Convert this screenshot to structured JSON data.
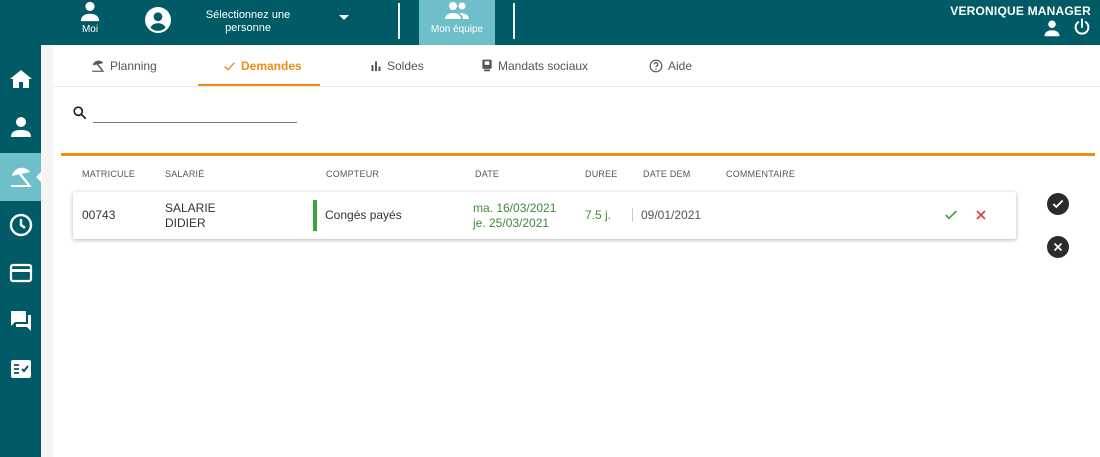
{
  "topbar": {
    "moi_label": "Moi",
    "select_person_label": "Sélectionnez une personne",
    "team_label": "Mon équipe",
    "user_name": "VERONIQUE MANAGER"
  },
  "sidebar": {
    "items": [
      {
        "icon": "home-icon"
      },
      {
        "icon": "person-icon"
      },
      {
        "icon": "beach-umbrella-icon",
        "active": true
      },
      {
        "icon": "clock-icon"
      },
      {
        "icon": "credit-card-icon"
      },
      {
        "icon": "chat-icon"
      },
      {
        "icon": "checklist-icon"
      }
    ]
  },
  "tabs": [
    {
      "label": "Planning",
      "icon": "beach-umbrella-icon"
    },
    {
      "label": "Demandes",
      "icon": "check-icon",
      "active": true
    },
    {
      "label": "Soldes",
      "icon": "bar-chart-icon"
    },
    {
      "label": "Mandats sociaux",
      "icon": "badge-icon"
    },
    {
      "label": "Aide",
      "icon": "help-icon"
    }
  ],
  "search": {
    "placeholder": "",
    "value": ""
  },
  "table": {
    "headers": {
      "matricule": "MATRICULE",
      "salarie": "SALARIÉ",
      "compteur": "COMPTEUR",
      "date": "DATE",
      "duree": "DUREE",
      "date_dem": "DATE DEM",
      "commentaire": "COMMENTAIRE"
    },
    "rows": [
      {
        "matricule": "00743",
        "salarie_last": "SALARIE",
        "salarie_first": "DIDIER",
        "compteur": "Congés payés",
        "date_start": "ma. 16/03/2021",
        "date_end": "je. 25/03/2021",
        "duree": "7.5 j.",
        "date_dem": "09/01/2021",
        "commentaire": ""
      }
    ]
  },
  "colors": {
    "primary": "#005b66",
    "accent": "#ef8c13",
    "highlight": "#6fbfca",
    "approve": "#3ca33c",
    "reject": "#e53935"
  }
}
